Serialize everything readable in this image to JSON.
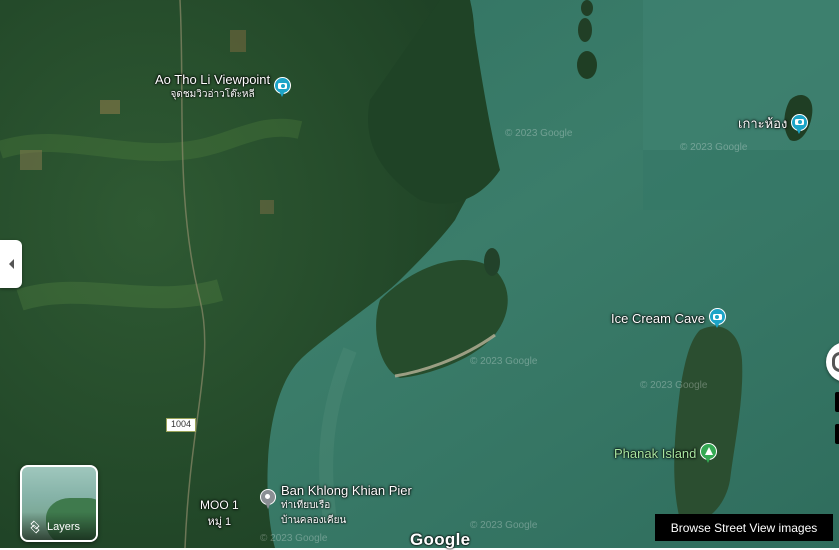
{
  "map": {
    "type": "satellite",
    "watermark": "© 2023 Google",
    "brand": "Google"
  },
  "places": {
    "ao_tho_li": {
      "name": "Ao Tho Li Viewpoint",
      "name_local": "จุดชมวิวอ่าวโต๊ะหลี",
      "icon": "camera-icon"
    },
    "ko_hong": {
      "name": "เกาะห้อง",
      "icon": "camera-icon"
    },
    "ice_cream_cave": {
      "name": "Ice Cream Cave",
      "icon": "camera-icon"
    },
    "phanak_island": {
      "name": "Phanak Island",
      "icon": "tree-icon"
    },
    "ban_khlong_khian": {
      "name": "Ban Khlong Khian Pier",
      "name_local_1": "ท่าเทียบเรือ",
      "name_local_2": "บ้านคลองเคียน",
      "icon": "place-icon"
    },
    "moo1": {
      "name": "MOO 1",
      "name_local": "หมู่ 1"
    }
  },
  "road_shield": {
    "label": "1004"
  },
  "controls": {
    "layers_label": "Layers",
    "browse_street_view": "Browse Street View images"
  },
  "colors": {
    "camera_pin": "#1ca4c7",
    "park_pin": "#34a853",
    "place_pin": "#8a8f94"
  }
}
